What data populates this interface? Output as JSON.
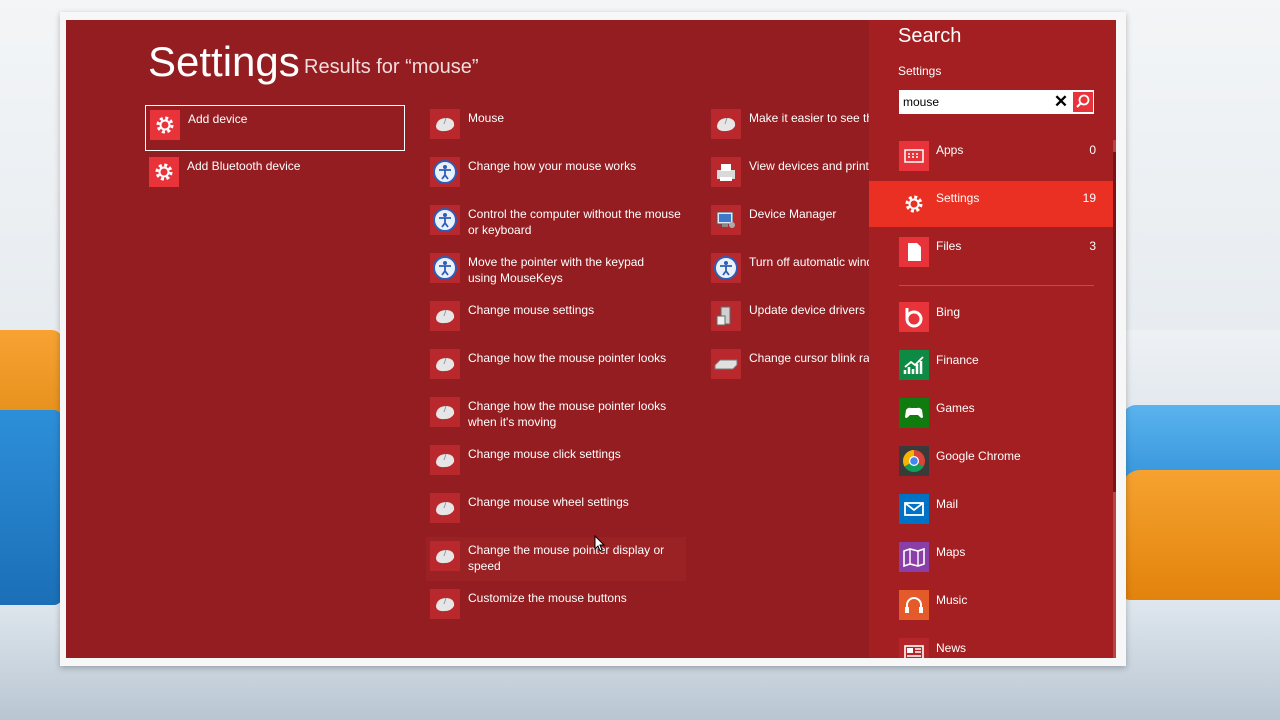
{
  "page": {
    "title": "Settings",
    "subtitle": "Results for “mouse”"
  },
  "results": {
    "col1": [
      {
        "label": "Add device",
        "icon": "gear-icon",
        "selected": true
      },
      {
        "label": "Add Bluetooth device",
        "icon": "gear-icon"
      }
    ],
    "col2": [
      {
        "label": "Mouse",
        "icon": "mouse-icon"
      },
      {
        "label": "Change how your mouse works",
        "icon": "ease-of-access-icon"
      },
      {
        "label": "Control the computer without the mouse or keyboard",
        "icon": "ease-of-access-icon"
      },
      {
        "label": "Move the pointer with the keypad using MouseKeys",
        "icon": "ease-of-access-icon"
      },
      {
        "label": "Change mouse settings",
        "icon": "mouse-icon"
      },
      {
        "label": "Change how the mouse pointer looks",
        "icon": "mouse-icon"
      },
      {
        "label": "Change how the mouse pointer looks when it's moving",
        "icon": "mouse-icon"
      },
      {
        "label": "Change mouse click settings",
        "icon": "mouse-icon"
      },
      {
        "label": "Change mouse wheel settings",
        "icon": "mouse-icon"
      },
      {
        "label": "Change the mouse pointer display or speed",
        "icon": "mouse-icon"
      },
      {
        "label": "Customize the mouse buttons",
        "icon": "mouse-icon"
      }
    ],
    "col3": [
      {
        "label": "Make it easier to see the m",
        "icon": "mouse-icon"
      },
      {
        "label": "View devices and printers",
        "icon": "printer-icon"
      },
      {
        "label": "Device Manager",
        "icon": "device-manager-icon"
      },
      {
        "label": "Turn off automatic windo",
        "icon": "ease-of-access-icon"
      },
      {
        "label": "Update device drivers",
        "icon": "device-drivers-icon"
      },
      {
        "label": "Change cursor blink rate",
        "icon": "keyboard-icon"
      }
    ]
  },
  "search": {
    "title": "Search",
    "scope_label": "Settings",
    "query": "mouse",
    "clear_icon": "close-icon",
    "go_icon": "search-icon",
    "scopes": [
      {
        "label": "Apps",
        "count": "0",
        "icon": "apps-icon"
      },
      {
        "label": "Settings",
        "count": "19",
        "icon": "gear-icon",
        "active": true
      },
      {
        "label": "Files",
        "count": "3",
        "icon": "file-icon"
      }
    ],
    "apps": [
      {
        "label": "Bing",
        "icon": "bing-icon",
        "color": "#e8333a"
      },
      {
        "label": "Finance",
        "icon": "finance-icon",
        "color": "#0e8a45"
      },
      {
        "label": "Games",
        "icon": "games-icon",
        "color": "#107c10"
      },
      {
        "label": "Google Chrome",
        "icon": "chrome-icon",
        "color": "#3a3a3a"
      },
      {
        "label": "Mail",
        "icon": "mail-icon",
        "color": "#0072c6"
      },
      {
        "label": "Maps",
        "icon": "maps-icon",
        "color": "#8a3fa8"
      },
      {
        "label": "Music",
        "icon": "music-icon",
        "color": "#e45a2b"
      },
      {
        "label": "News",
        "icon": "news-icon",
        "color": "#b5262b"
      }
    ]
  },
  "colors": {
    "main_bg": "#931d20",
    "pane_bg": "#a41f21",
    "accent": "#ea3023"
  }
}
